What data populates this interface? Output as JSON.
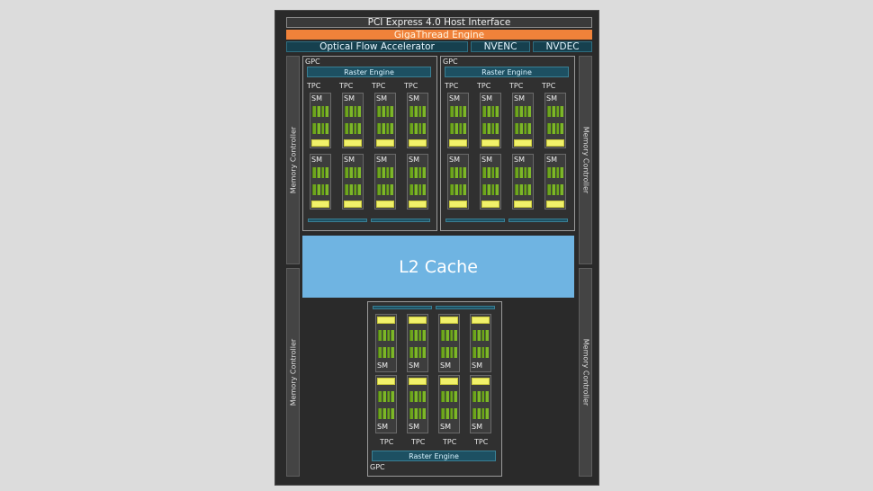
{
  "host_interface": "PCI Express 4.0 Host Interface",
  "gigathread": "GigaThread Engine",
  "optical_flow": "Optical Flow Accelerator",
  "nvenc": "NVENC",
  "nvdec": "NVDEC",
  "memory_controller": "Memory Controller",
  "l2_cache": "L2 Cache",
  "gpc_label": "GPC",
  "raster_engine": "Raster Engine",
  "tpc_label": "TPC",
  "sm_label": "SM",
  "colors": {
    "accent_orange": "#f0823a",
    "l2_blue": "#6fb4e2",
    "core_green": "#6ea51e",
    "rt_yellow": "#f1f16a",
    "engine_teal": "#16404e"
  }
}
